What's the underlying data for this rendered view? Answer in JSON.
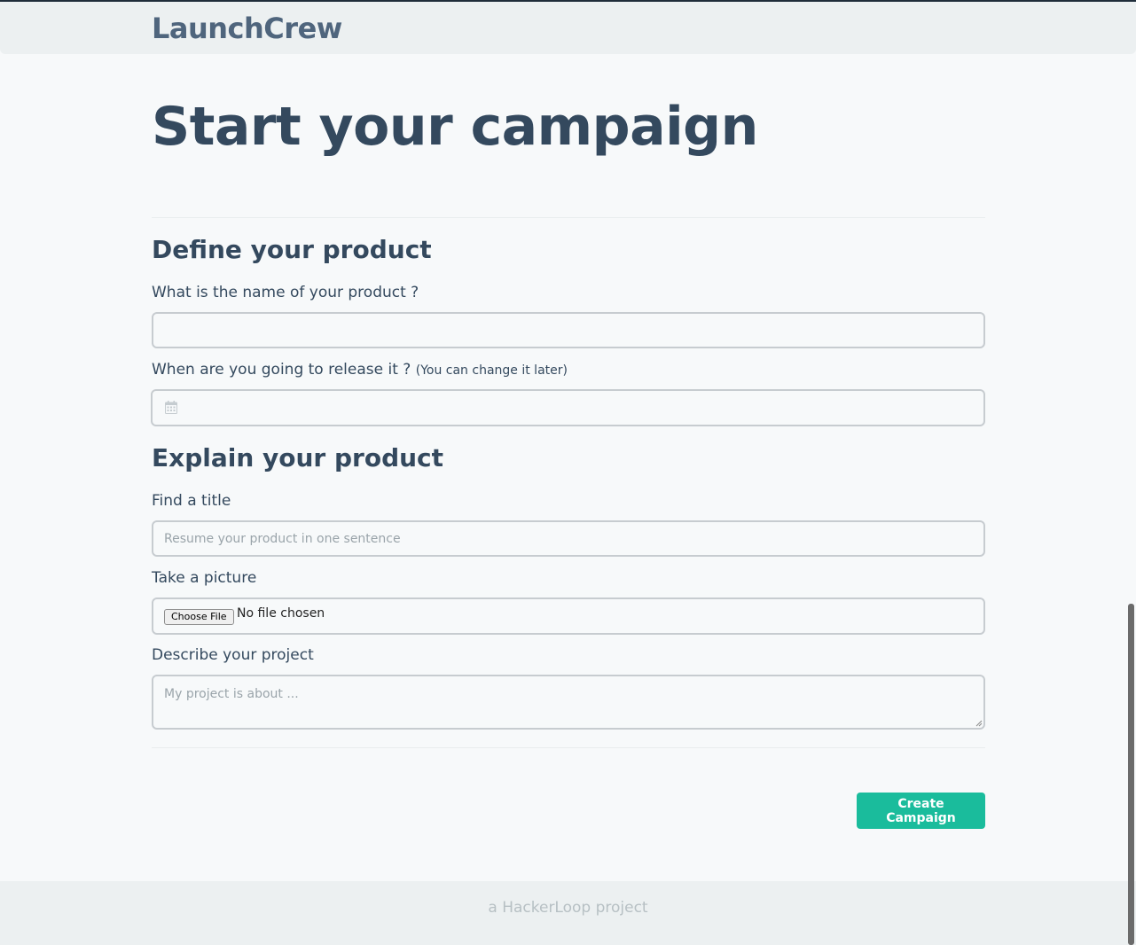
{
  "navbar": {
    "brand": "LaunchCrew"
  },
  "page": {
    "title": "Start your campaign"
  },
  "define": {
    "heading": "Define your product",
    "name_label": "What is the name of your product ?",
    "name_value": "",
    "release_label": "When are you going to release it ?",
    "release_hint": "(You can change it later)",
    "release_value": ""
  },
  "explain": {
    "heading": "Explain your product",
    "title_label": "Find a title",
    "title_placeholder": "Resume your product in one sentence",
    "picture_label": "Take a picture",
    "file_button": "Choose File",
    "file_status": "No file chosen",
    "describe_label": "Describe your project",
    "describe_placeholder": "My project is about ..."
  },
  "actions": {
    "create_label": "Create Campaign"
  },
  "footer": {
    "text": "a HackerLoop project"
  },
  "colors": {
    "accent": "#1abc9c",
    "text": "#34495e",
    "navbar": "#ecf0f1"
  },
  "icons": {
    "date_field": "calendar-icon"
  }
}
